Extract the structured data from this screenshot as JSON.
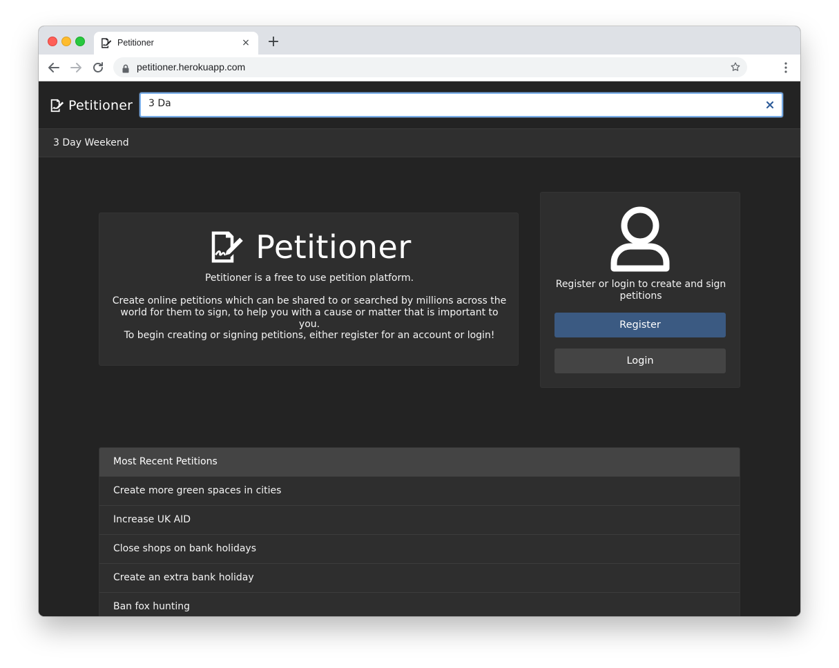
{
  "browser": {
    "tab_title": "Petitioner",
    "url": "petitioner.herokuapp.com",
    "new_tab_symbol": "+",
    "tab_close_symbol": "×"
  },
  "navbar": {
    "brand": "Petitioner",
    "search": {
      "value": "3 Da",
      "placeholder": ""
    },
    "suggestions": [
      "3 Day Weekend"
    ]
  },
  "hero": {
    "title": "Petitioner",
    "intro": "Petitioner is a free to use petition platform.",
    "description": "Create online petitions which can be shared to or searched by millions across the world for them to sign, to help you with a cause or matter that is important to you.",
    "cta": "To begin creating or signing petitions, either register for an account or login!"
  },
  "auth": {
    "prompt": "Register or login to create and sign petitions",
    "register_label": "Register",
    "login_label": "Login"
  },
  "recent": {
    "header": "Most Recent Petitions",
    "items": [
      "Create more green spaces in cities",
      "Increase UK AID",
      "Close shops on bank holidays",
      "Create an extra bank holiday",
      "Ban fox hunting"
    ]
  },
  "colors": {
    "page_bg": "#232323",
    "card_bg": "#2e2e2e",
    "register_bg": "#3b5a82",
    "login_bg": "#444444",
    "focus_border": "#7aaee8"
  },
  "icons": {
    "tab_favicon": "signature-icon",
    "brand": "signature-icon",
    "hero_logo": "signature-icon",
    "auth": "user-icon",
    "search_clear": "close-icon"
  }
}
